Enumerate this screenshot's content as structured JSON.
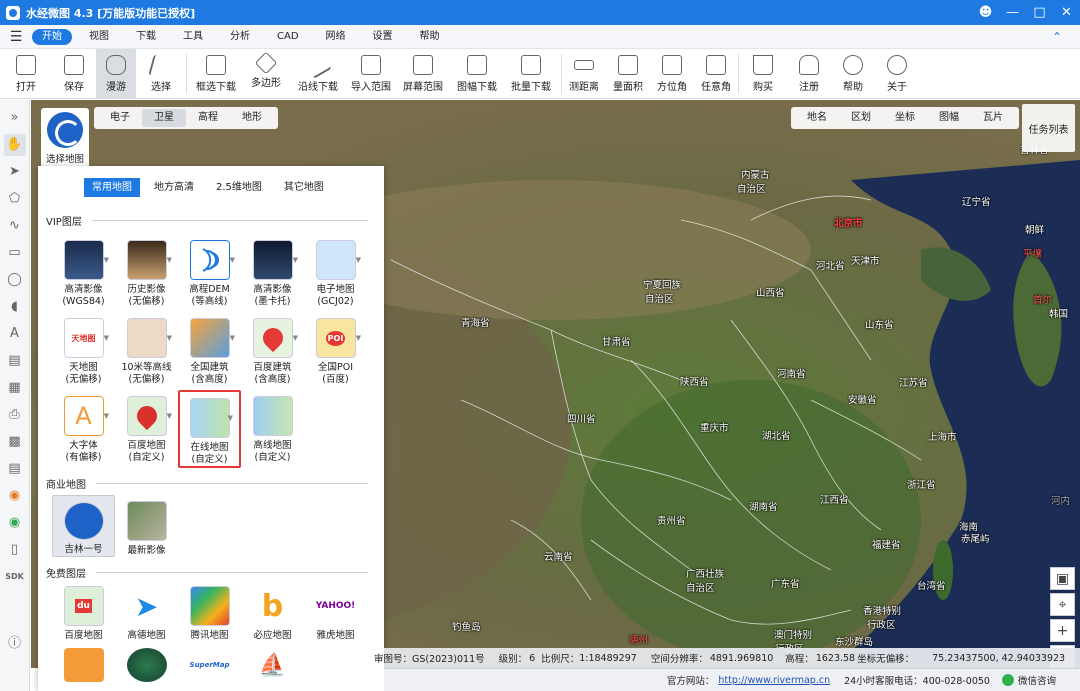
{
  "window": {
    "title": "水经微图 4.3 [万能版功能已授权]"
  },
  "menu": {
    "items": [
      "开始",
      "视图",
      "下载",
      "工具",
      "分析",
      "CAD",
      "网络",
      "设置",
      "帮助"
    ],
    "active": "开始"
  },
  "toolbar": {
    "items": [
      "打开",
      "保存",
      "漫游",
      "选择",
      "框选下载",
      "多边形",
      "沿线下载",
      "导入范围",
      "屏幕范围",
      "图幅下载",
      "批量下载",
      "测距离",
      "量面积",
      "方位角",
      "任意角",
      "购买",
      "注册",
      "帮助",
      "关于"
    ],
    "selected": "漫游"
  },
  "maptabs_left": {
    "items": [
      "电子",
      "卫星",
      "高程",
      "地形"
    ],
    "active": "卫星"
  },
  "maptabs_right": {
    "items": [
      "地名",
      "区划",
      "坐标",
      "图幅",
      "瓦片"
    ]
  },
  "task_list": "任务列表",
  "selector": {
    "label": "选择地图"
  },
  "panel": {
    "tabs": [
      "常用地图",
      "地方高清",
      "2.5维地图",
      "其它地图"
    ],
    "active_tab": "常用地图",
    "vip_title": "VIP图层",
    "vip": [
      {
        "l1": "高清影像",
        "l2": "(WGS84)"
      },
      {
        "l1": "历史影像",
        "l2": "(无偏移)"
      },
      {
        "l1": "高程DEM",
        "l2": "(等高线)"
      },
      {
        "l1": "高清影像",
        "l2": "(墨卡托)"
      },
      {
        "l1": "电子地图",
        "l2": "(GCJ02)"
      },
      {
        "l1": "天地图",
        "l2": "(无偏移)"
      },
      {
        "l1": "10米等高线",
        "l2": "(无偏移)"
      },
      {
        "l1": "全国建筑",
        "l2": "(含高度)"
      },
      {
        "l1": "百度建筑",
        "l2": "(含高度)"
      },
      {
        "l1": "全国POI",
        "l2": "(百度)"
      },
      {
        "l1": "大字体",
        "l2": "(有偏移)"
      },
      {
        "l1": "百度地图",
        "l2": "(自定义)"
      },
      {
        "l1": "在线地图",
        "l2": "(自定义)"
      },
      {
        "l1": "高线地图",
        "l2": "(自定义)"
      }
    ],
    "commercial_title": "商业地图",
    "commercial": [
      {
        "l1": "吉林一号"
      },
      {
        "l1": "最新影像"
      }
    ],
    "free_title": "免费图层",
    "free": [
      {
        "l1": "百度地图"
      },
      {
        "l1": "高德地图"
      },
      {
        "l1": "腾讯地图"
      },
      {
        "l1": "必应地图"
      },
      {
        "l1": "雅虎地图"
      }
    ],
    "thumb_text": {
      "tianditu": "天地图",
      "poi": "POI",
      "baidu": "du",
      "yahoo": "YAHOO!",
      "supermap": "SuperMap"
    }
  },
  "map_labels": [
    "内蒙古",
    "自治区",
    "北京市",
    "天津市",
    "辽宁省",
    "朝鲜",
    "平壤",
    "首尔",
    "韩国",
    "吉林省",
    "河北省",
    "宁夏回族",
    "自治区",
    "山西省",
    "山东省",
    "甘肃省",
    "青海省",
    "陕西省",
    "河南省",
    "江苏省",
    "安徽省",
    "湖北省",
    "上海市",
    "四川省",
    "重庆市",
    "浙江省",
    "湖南省",
    "江西省",
    "贵州省",
    "福建省",
    "云南省",
    "广西壮族",
    "自治区",
    "广东省",
    "台湾省",
    "香港特别",
    "行政区",
    "澳门特别",
    "行政区",
    "东沙群岛",
    "海南",
    "赤尾屿",
    "钓鱼岛",
    "德州",
    "河内",
    "吉林"
  ],
  "status": {
    "approval": "审图号：GS(2023)011号",
    "level_label": "级别：",
    "level": "6",
    "scale_label": "比例尺：",
    "scale": "1:18489297",
    "resolution_label": "空间分辨率：",
    "resolution": "4891.969810",
    "elevation_label": "高程：",
    "elevation": "1623.58",
    "coord_label": "坐标无偏移：",
    "coords": "75.23437500, 42.94033923"
  },
  "footer": {
    "site_label": "官方网站：",
    "site_url": "http://www.rivermap.cn",
    "hotline": "24小时客服电话：400-028-0050",
    "wechat": "微信咨询"
  },
  "left_tools": [
    "展开",
    "平移",
    "选择",
    "多边形",
    "折线",
    "矩形",
    "圆形",
    "扇形",
    "文字",
    "测量",
    "图层",
    "打印",
    "导出",
    "模板",
    "网络",
    "地图",
    "SDK",
    "帮助"
  ]
}
